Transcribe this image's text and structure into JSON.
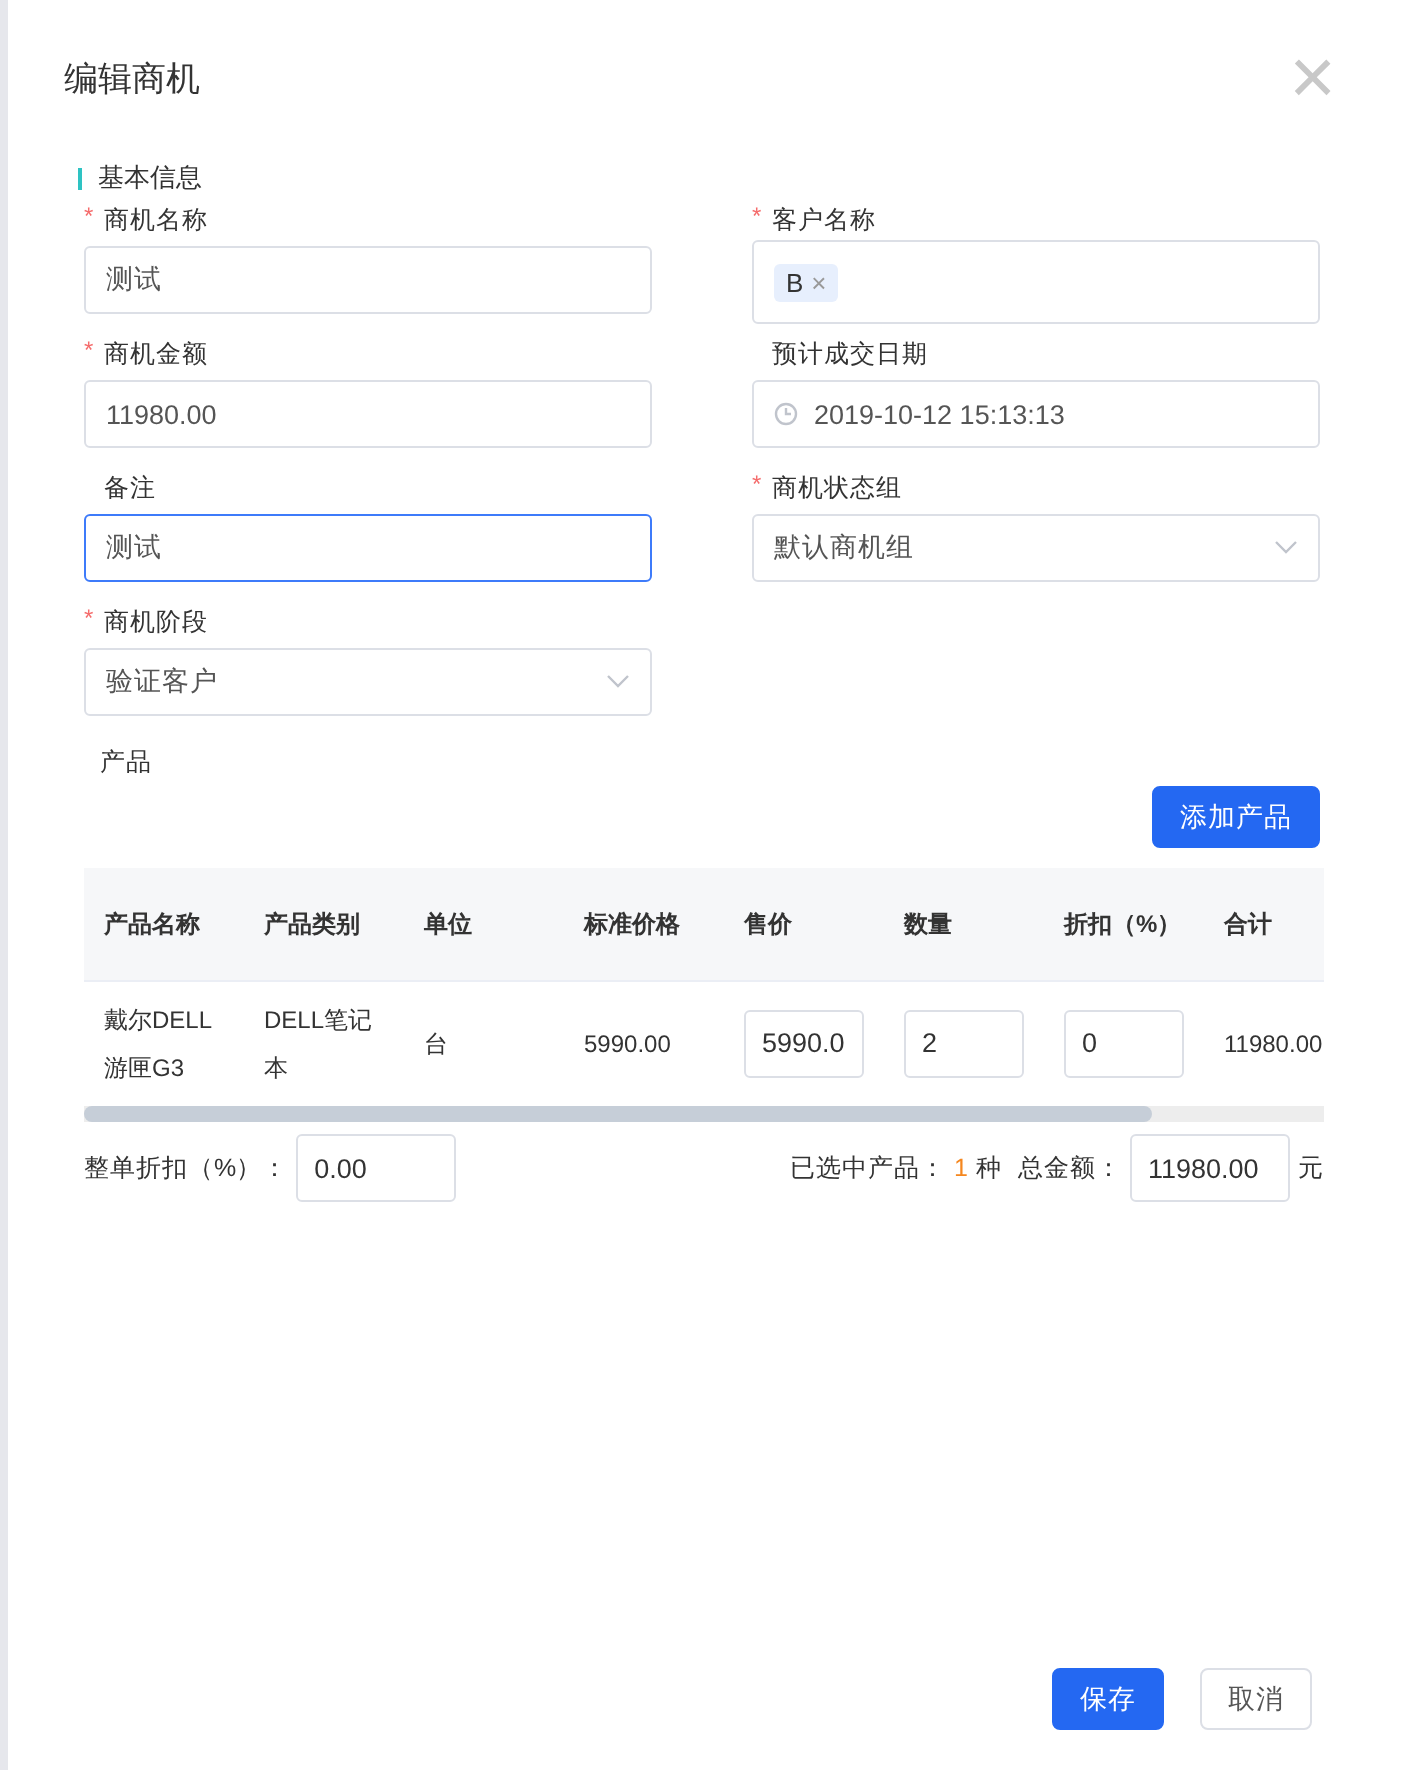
{
  "dialog": {
    "title": "编辑商机",
    "close": "×"
  },
  "section": {
    "title": "基本信息"
  },
  "fields": [
    {
      "label": "商机名称",
      "required_mark": "*",
      "kind": "text",
      "value": "测试",
      "focused": false
    },
    {
      "label": "客户名称",
      "required_mark": "*",
      "kind": "tags",
      "tags": [
        {
          "label": "B",
          "remove": "×"
        }
      ],
      "focused": false
    },
    {
      "label": "商机金额",
      "required_mark": "*",
      "kind": "text",
      "value": "11980.00",
      "focused": false
    },
    {
      "label": "预计成交日期",
      "kind": "date",
      "value": "2019-10-12 15:13:13",
      "focused": false
    },
    {
      "label": "备注",
      "kind": "text",
      "value": "测试",
      "focused": true
    },
    {
      "label": "商机状态组",
      "required_mark": "*",
      "kind": "select",
      "value": "默认商机组",
      "focused": false
    },
    {
      "label": "商机阶段",
      "required_mark": "*",
      "kind": "select",
      "value": "验证客户",
      "focused": false
    }
  ],
  "products": {
    "label": "产品",
    "add_button": "添加产品",
    "table": {
      "columns": [
        "产品名称",
        "产品类别",
        "单位",
        "标准价格",
        "售价",
        "数量",
        "折扣（%）",
        "合计"
      ],
      "rows": [
        [
          {
            "kind": "text",
            "value": "戴尔DELL游匣G3"
          },
          {
            "kind": "text",
            "value": "DELL笔记本"
          },
          {
            "kind": "text",
            "value": "台"
          },
          {
            "kind": "text",
            "value": "5990.00"
          },
          {
            "kind": "input",
            "value": "5990.0"
          },
          {
            "kind": "input",
            "value": "2"
          },
          {
            "kind": "input",
            "value": "0"
          },
          {
            "kind": "text",
            "value": "11980.00"
          }
        ]
      ]
    },
    "discount_label": "整单折扣（%）：",
    "discount_value": "0.00",
    "selected_label": "已选中产品：",
    "selected_count": "1",
    "selected_unit": "种",
    "total_label": "总金额：",
    "total_value": "11980.00",
    "total_unit": "元"
  },
  "buttons": [
    {
      "label": "保存",
      "kind": "primary"
    },
    {
      "label": "取消",
      "kind": "default"
    }
  ]
}
